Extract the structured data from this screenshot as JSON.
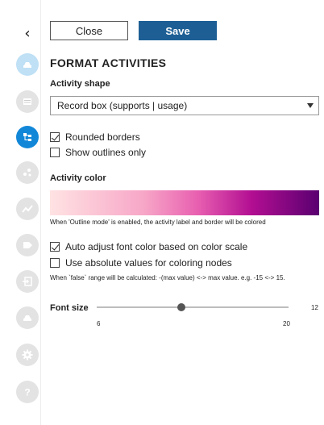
{
  "toolbar": {
    "close_label": "Close",
    "save_label": "Save"
  },
  "sidebar": {
    "collapse_icon": "chevron-left-icon",
    "items": [
      {
        "icon": "box-icon",
        "state": "light"
      },
      {
        "icon": "list-icon",
        "state": "inactive"
      },
      {
        "icon": "activities-icon",
        "state": "active"
      },
      {
        "icon": "nodes-icon",
        "state": "inactive"
      },
      {
        "icon": "trend-icon",
        "state": "inactive"
      },
      {
        "icon": "tag-icon",
        "state": "inactive"
      },
      {
        "icon": "import-icon",
        "state": "inactive"
      },
      {
        "icon": "box-icon",
        "state": "inactive"
      },
      {
        "icon": "gear-icon",
        "state": "inactive"
      },
      {
        "icon": "help-icon",
        "state": "inactive"
      }
    ]
  },
  "panel": {
    "title": "FORMAT ACTIVITIES",
    "shape_label": "Activity shape",
    "shape_value": "Record box (supports | usage)",
    "rounded_label": "Rounded borders",
    "rounded_checked": true,
    "outlines_label": "Show outlines only",
    "outlines_checked": false,
    "color_label": "Activity color",
    "outline_note": "When 'Outline mode' is enabled, the activity label and border will be colored",
    "auto_adjust_label": "Auto adjust font color based on color scale",
    "auto_adjust_checked": true,
    "absolute_label": "Use absolute values for coloring nodes",
    "absolute_checked": false,
    "absolute_note": "When `false` range will be calculated: -(max value) <-> max value. e.g. -15 <-> 15.",
    "font_size_label": "Font size",
    "font_size_value": "12",
    "font_size_min": "6",
    "font_size_max": "20",
    "gradient_colors": [
      "#ffe3e3",
      "#f7a6c7",
      "#e85fb0",
      "#b20e92",
      "#5a0070"
    ]
  }
}
